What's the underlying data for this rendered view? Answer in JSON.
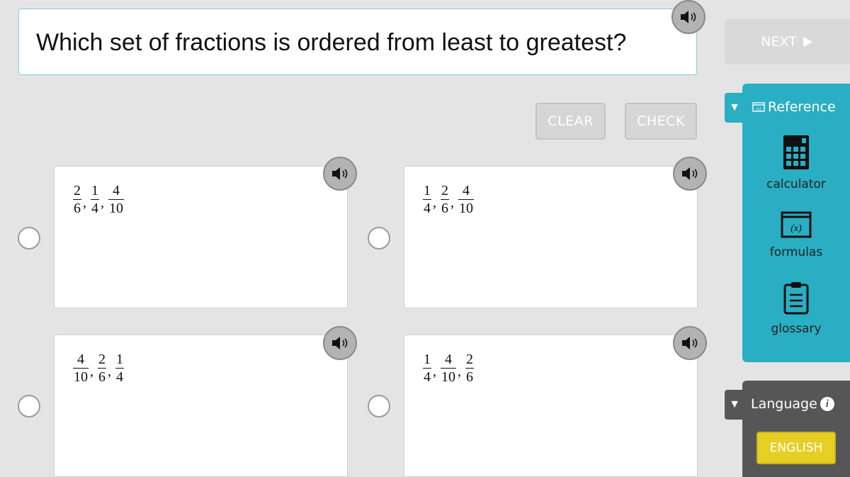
{
  "question": {
    "text": "Which set of fractions is ordered from least to greatest?"
  },
  "toolbar": {
    "next_label": "NEXT",
    "clear_label": "CLEAR",
    "check_label": "CHECK"
  },
  "answers": [
    {
      "fractions": [
        {
          "num": "2",
          "den": "6"
        },
        {
          "num": "1",
          "den": "4"
        },
        {
          "num": "4",
          "den": "10"
        }
      ]
    },
    {
      "fractions": [
        {
          "num": "1",
          "den": "4"
        },
        {
          "num": "2",
          "den": "6"
        },
        {
          "num": "4",
          "den": "10"
        }
      ]
    },
    {
      "fractions": [
        {
          "num": "4",
          "den": "10"
        },
        {
          "num": "2",
          "den": "6"
        },
        {
          "num": "1",
          "den": "4"
        }
      ]
    },
    {
      "fractions": [
        {
          "num": "1",
          "den": "4"
        },
        {
          "num": "4",
          "den": "10"
        },
        {
          "num": "2",
          "den": "6"
        }
      ]
    }
  ],
  "reference": {
    "title": "Reference",
    "tools": [
      {
        "label": "calculator",
        "icon": "calculator-icon"
      },
      {
        "label": "formulas",
        "icon": "formulas-icon"
      },
      {
        "label": "glossary",
        "icon": "clipboard-icon"
      }
    ]
  },
  "language": {
    "title": "Language",
    "selected": "ENGLISH"
  },
  "colors": {
    "reference_panel": "#2aaec3",
    "language_panel": "#565656",
    "english_button": "#e6cf24",
    "question_border": "#7fd0df"
  }
}
